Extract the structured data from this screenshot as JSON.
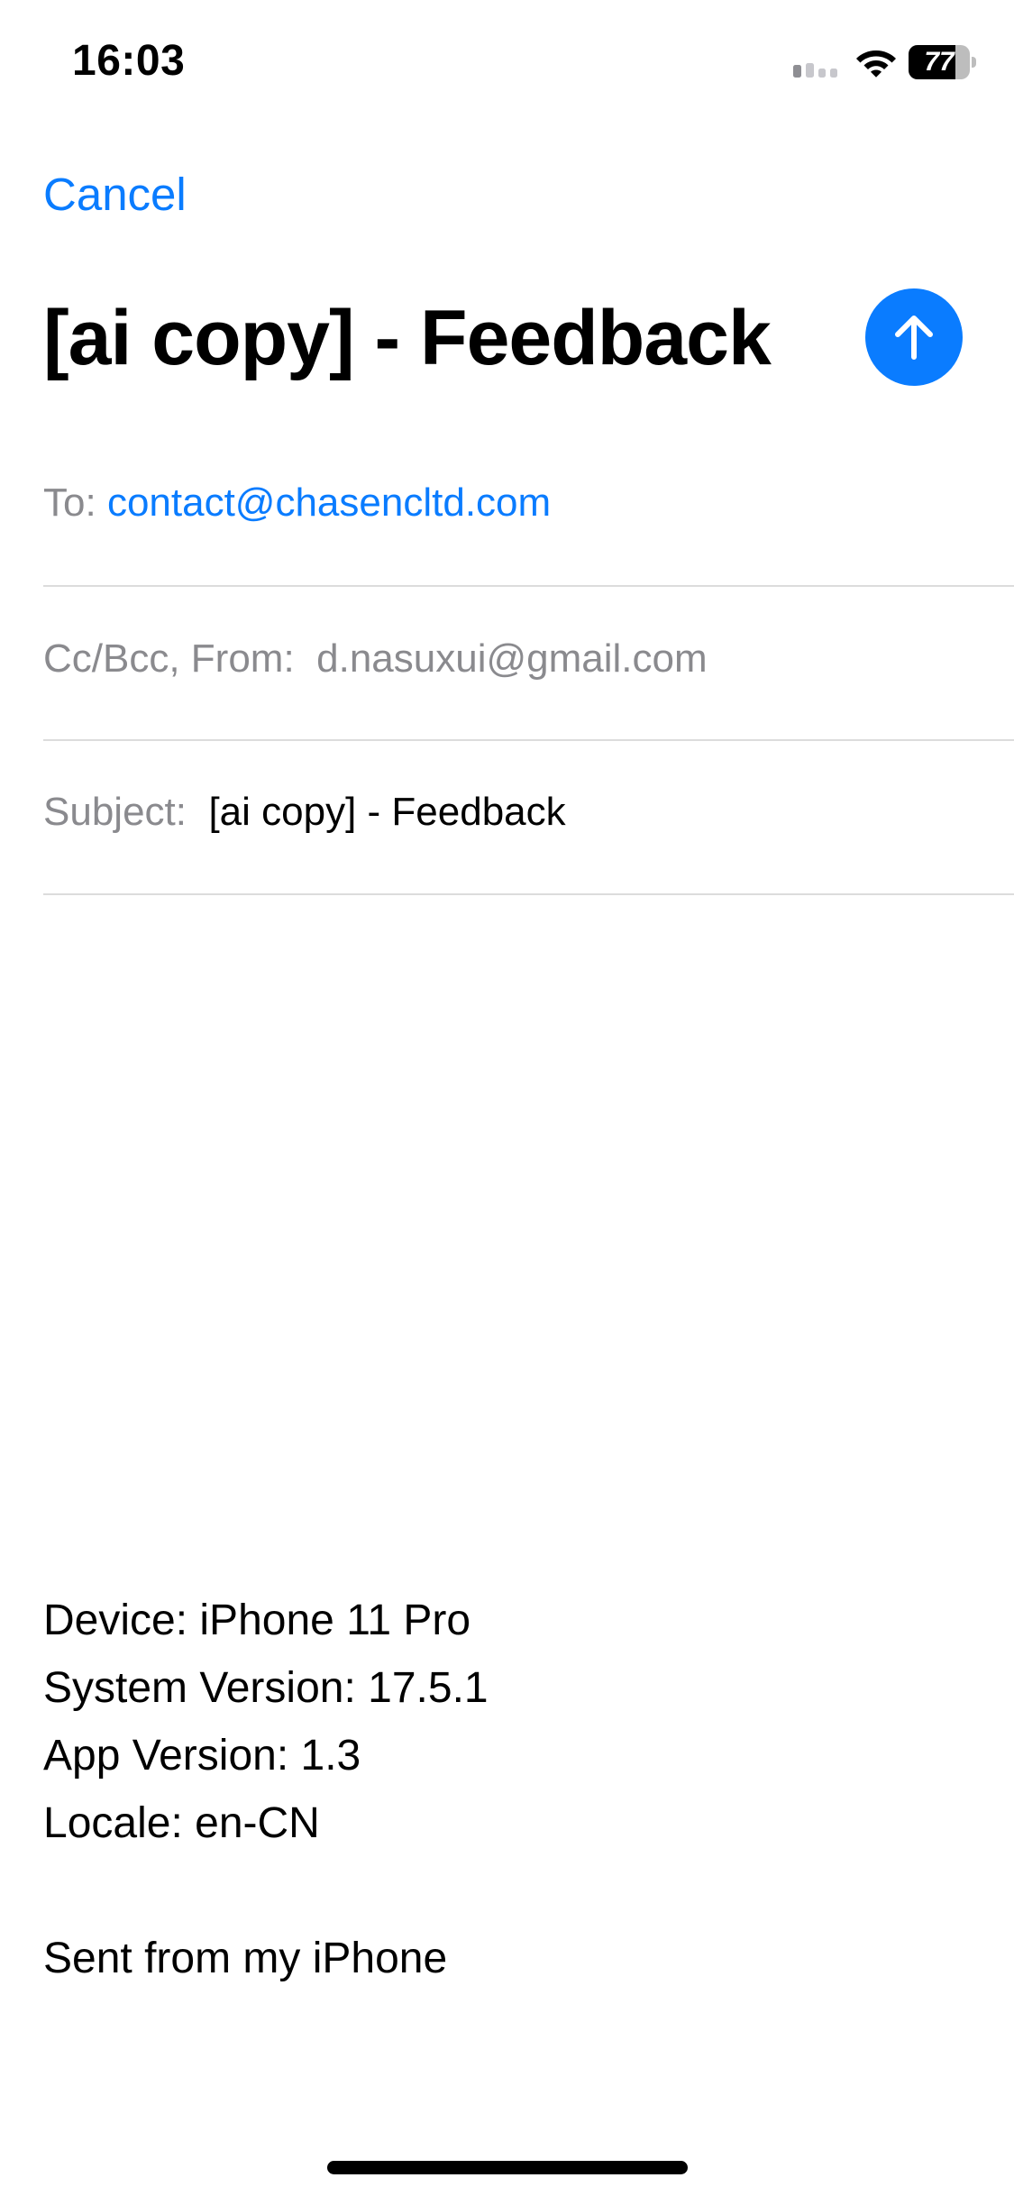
{
  "status_bar": {
    "time": "16:03",
    "battery_level": "77",
    "battery_fraction": 0.77,
    "icons": [
      "signal-icon",
      "wifi-icon",
      "battery-icon"
    ]
  },
  "nav": {
    "cancel_label": "Cancel",
    "send_icon": "arrow-up-icon"
  },
  "title": "[ai copy] - Feedback",
  "fields": {
    "to_label": "To:",
    "to_value": "contact@chasencltd.com",
    "from_label": "Cc/Bcc, From:",
    "from_value": "d.nasuxui@gmail.com",
    "subject_label": "Subject:",
    "subject_value": "[ai copy] - Feedback"
  },
  "body": {
    "lines": [
      "Device: iPhone 11 Pro",
      "System Version: 17.5.1",
      "App Version: 1.3",
      "Locale: en-CN"
    ],
    "signature": "Sent from my iPhone"
  },
  "colors": {
    "accent": "#0a7cff",
    "label": "#8a8a8e",
    "separator": "#dcdcdc",
    "background": "#ffffff"
  }
}
